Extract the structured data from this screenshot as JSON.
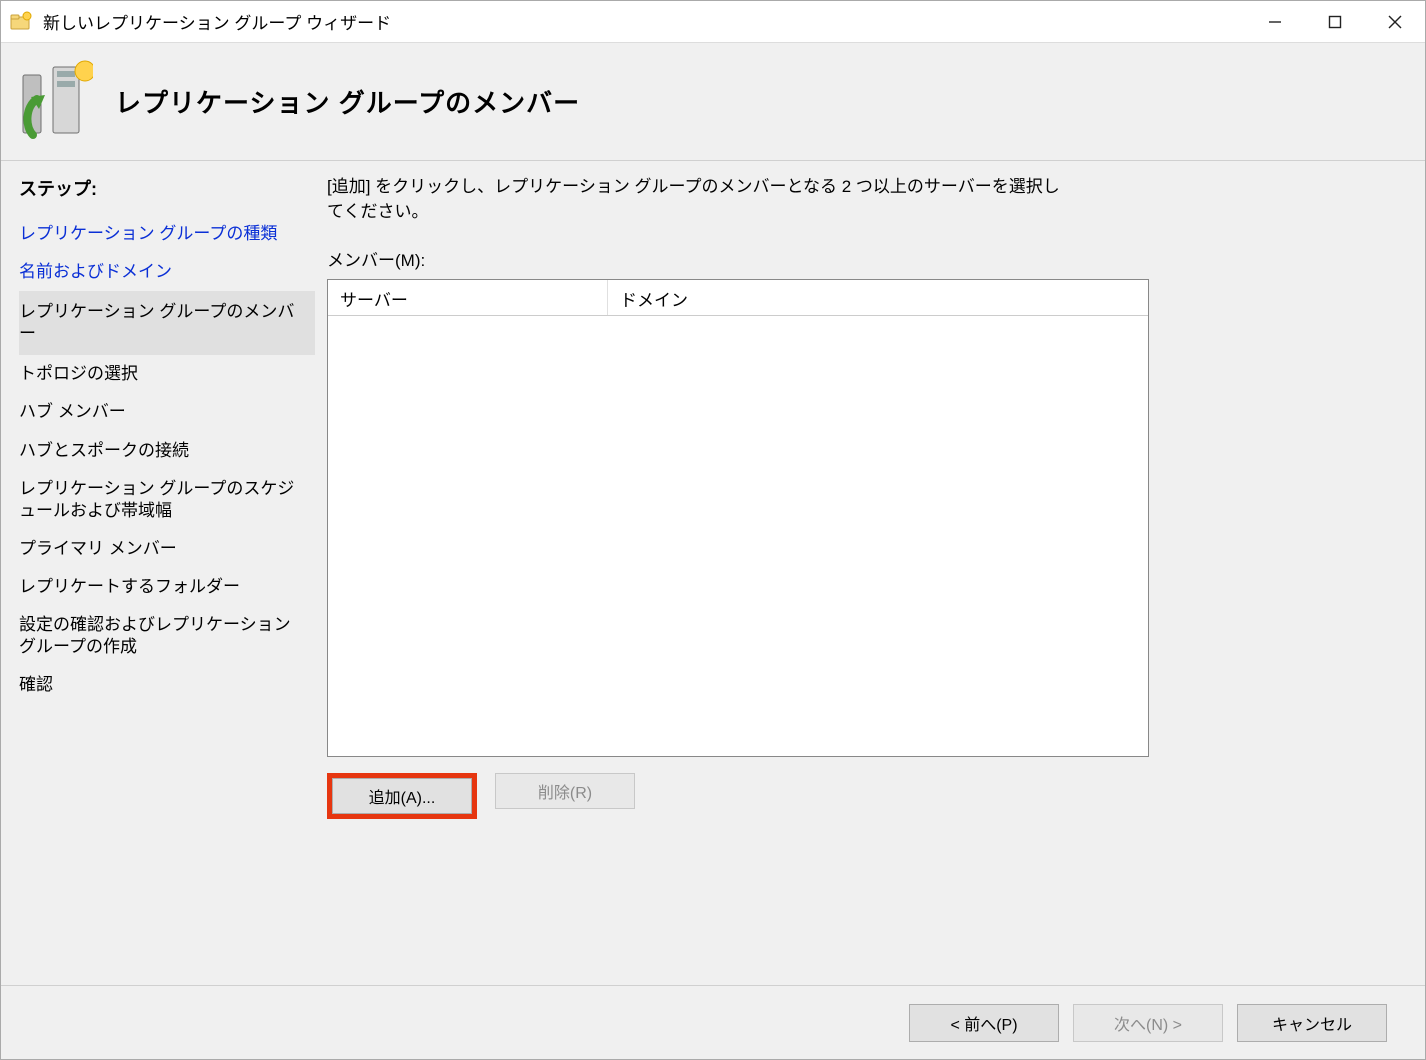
{
  "window": {
    "title": "新しいレプリケーション グループ ウィザード"
  },
  "header": {
    "title": "レプリケーション グループのメンバー"
  },
  "sidebar": {
    "caption": "ステップ:",
    "steps": [
      {
        "label": "レプリケーション グループの種類",
        "state": "visited"
      },
      {
        "label": "名前およびドメイン",
        "state": "visited"
      },
      {
        "label": "レプリケーション グループのメンバー",
        "state": "current"
      },
      {
        "label": "トポロジの選択",
        "state": "future"
      },
      {
        "label": "ハブ メンバー",
        "state": "future"
      },
      {
        "label": "ハブとスポークの接続",
        "state": "future"
      },
      {
        "label": "レプリケーション グループのスケジュールおよび帯域幅",
        "state": "future"
      },
      {
        "label": "プライマリ メンバー",
        "state": "future"
      },
      {
        "label": "レプリケートするフォルダー",
        "state": "future"
      },
      {
        "label": "設定の確認およびレプリケーション グループの作成",
        "state": "future"
      },
      {
        "label": "確認",
        "state": "future"
      }
    ]
  },
  "main": {
    "instruction": "[追加] をクリックし、レプリケーション グループのメンバーとなる 2 つ以上のサーバーを選択してください。",
    "members_label": "メンバー(M):",
    "columns": {
      "server": "サーバー",
      "domain": "ドメイン"
    },
    "rows": [],
    "buttons": {
      "add": "追加(A)...",
      "remove": "削除(R)"
    }
  },
  "footer": {
    "back": "< 前へ(P)",
    "next": "次へ(N) >",
    "cancel": "キャンセル"
  }
}
